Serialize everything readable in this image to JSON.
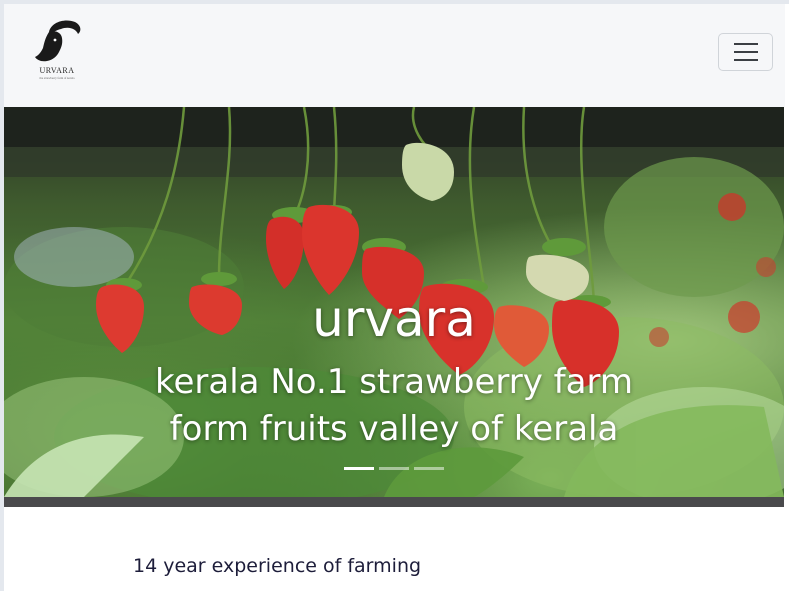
{
  "navbar": {
    "brand_name": "URVARA",
    "brand_tagline": "the strawberry farm of kerala",
    "toggler_icon": "hamburger-icon"
  },
  "hero": {
    "title": "urvara",
    "caption_line1": "kerala No.1 strawberry farm",
    "caption_line2": "form fruits valley of kerala",
    "slides": [
      "slide-1",
      "slide-2",
      "slide-3"
    ],
    "active_slide": 0
  },
  "section": {
    "experience_text": "14 year experience of farming"
  },
  "colors": {
    "navbar_bg": "#f6f7f9",
    "hero_text": "#ffffff",
    "body_text": "#1d1d3a",
    "strawberry": "#d9302a"
  }
}
